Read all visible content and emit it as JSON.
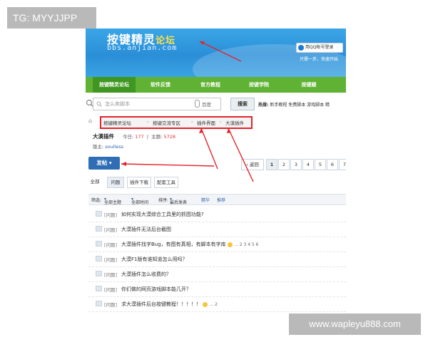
{
  "watermark_tl": "TG: MYYJJPP",
  "watermark_br": "www.wapleyu888.com",
  "header": {
    "title_main": "按键精灵",
    "title_sub": "论坛",
    "url": "bbs.anjian.com",
    "qq_login": "用QQ帐号登录",
    "links": "只需一步，快速开始"
  },
  "nav": [
    "按键精灵论坛",
    "软件反馈",
    "官方教程",
    "按键学院",
    "按键疑"
  ],
  "search": {
    "placeholder": "怎么卖脚本",
    "scope": "百度",
    "button": "搜索",
    "hot_label": "热搜:",
    "hot_items": "新手教程 免费脚本 游戏脚本 精"
  },
  "breadcrumb": [
    "按键精灵论坛",
    "按键交流专区",
    "插件界面",
    "大漠插件"
  ],
  "forum": {
    "name": "大漠插件",
    "today_label": "今日:",
    "today": "177",
    "topics_label": "主题:",
    "topics": "5728",
    "mod_label": "版主:",
    "mod": "soulless"
  },
  "post_button": "发帖",
  "pager": {
    "back": "返回",
    "pages": [
      "1",
      "2",
      "3",
      "4",
      "5",
      "6",
      "7"
    ]
  },
  "tabs": [
    "全部",
    "问题",
    "插件下载",
    "配套工具"
  ],
  "filter": [
    "筛选:",
    "全部主题",
    "全部时间",
    "排序:",
    "最后发表",
    "精华",
    "推荐"
  ],
  "threads": [
    {
      "tag": "[问题]",
      "title": "如何实现大漠综合工具里的抓图功能?",
      "pages": ""
    },
    {
      "tag": "[问题]",
      "title": "大漠插件无法后台截图",
      "pages": ""
    },
    {
      "tag": "[问题]",
      "title": "大漠插件找字Bug，有图有真相，有脚本有字库",
      "pages": "... 2 3 4 5 6"
    },
    {
      "tag": "[问题]",
      "title": "大漠F1版有谁知道怎么用吗？",
      "pages": ""
    },
    {
      "tag": "[问题]",
      "title": "大漠插件怎么收费的？",
      "pages": ""
    },
    {
      "tag": "[问题]",
      "title": "你们做的网页游戏脚本能几开？",
      "pages": ""
    },
    {
      "tag": "[问题]",
      "title": "求大漠插件后台按键教程！！！！！",
      "pages": "... 2"
    }
  ],
  "colors": {
    "banner": "#2b8fd8",
    "nav": "#5fb233",
    "annotation": "#e3242b"
  }
}
